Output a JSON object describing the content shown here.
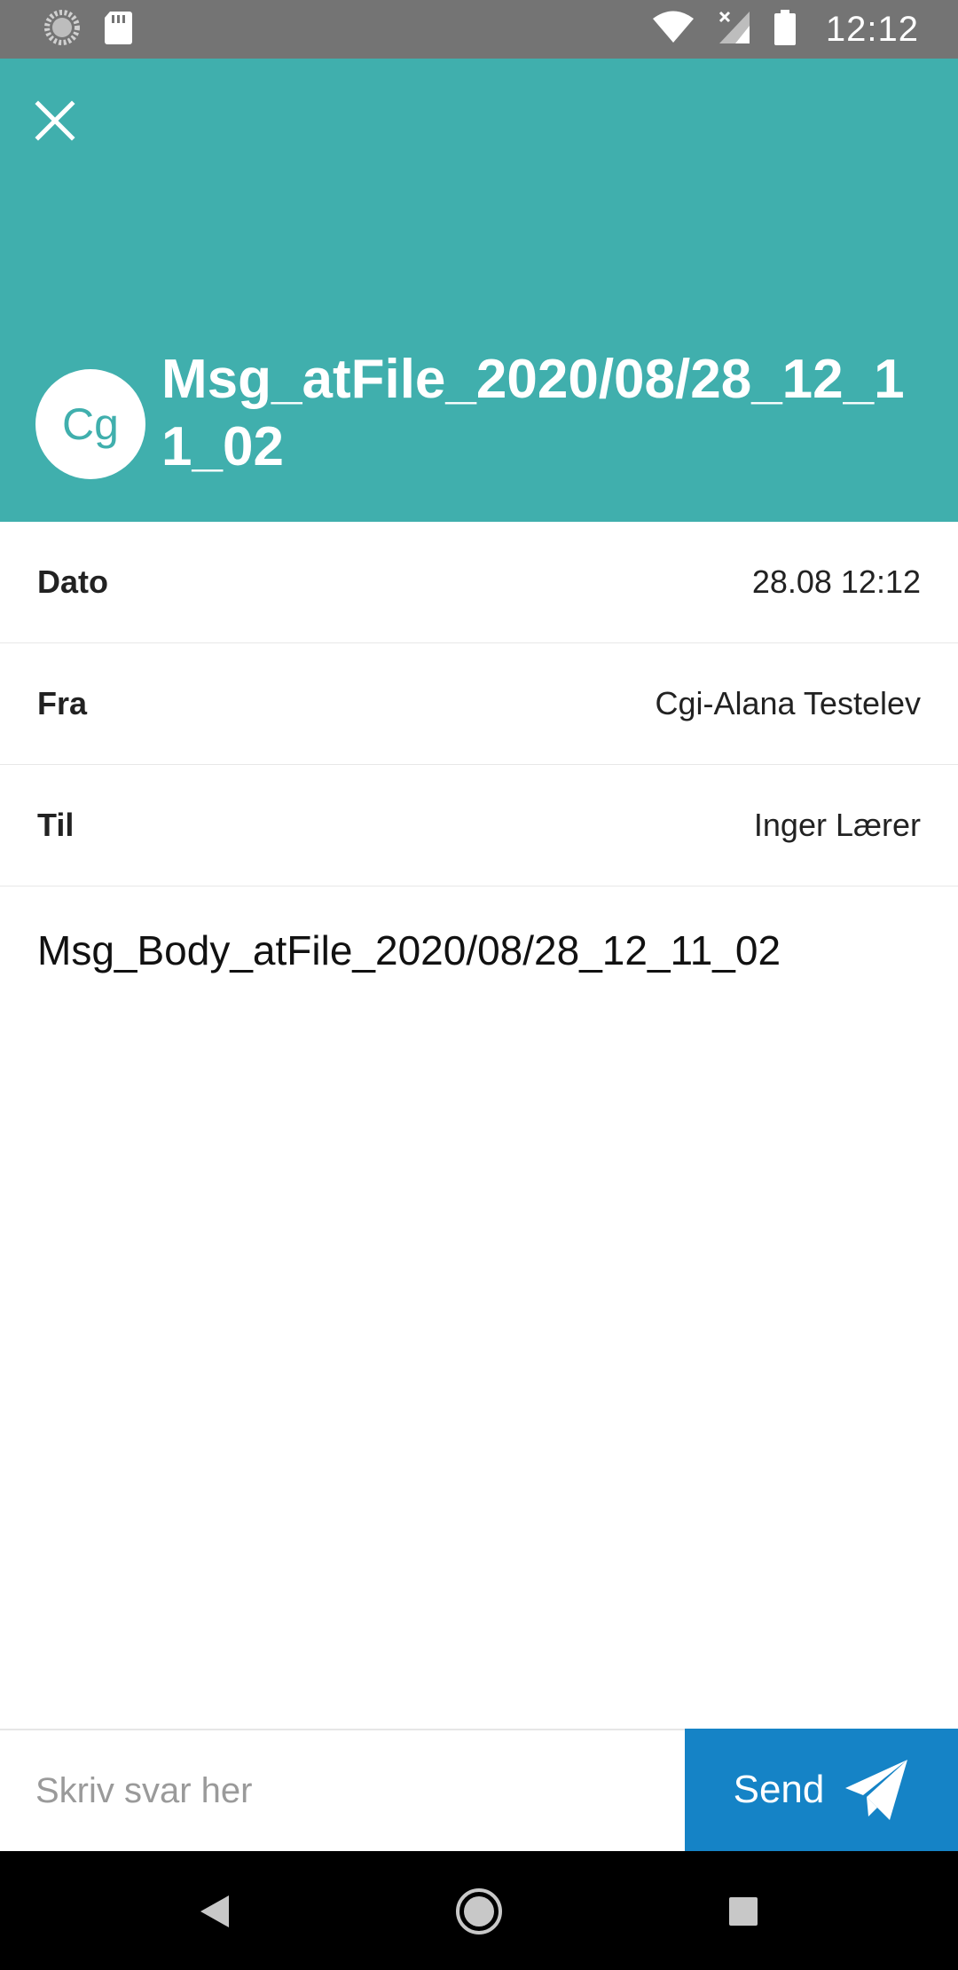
{
  "status_bar": {
    "time": "12:12",
    "icons": [
      "sync-icon",
      "sd-card-icon",
      "wifi-icon",
      "cellular-no-data-icon",
      "battery-icon"
    ],
    "background": "#747474"
  },
  "header": {
    "avatar_initials": "Cg",
    "title": "Msg_atFile_2020/08/28_12_11_02",
    "background": "#40afad"
  },
  "details": [
    {
      "label": "Dato",
      "value": "28.08 12:12"
    },
    {
      "label": "Fra",
      "value": "Cgi-Alana Testelev"
    },
    {
      "label": "Til",
      "value": "Inger Lærer"
    }
  ],
  "message": {
    "body": "Msg_Body_atFile_2020/08/28_12_11_02"
  },
  "reply": {
    "placeholder": "Skriv svar her",
    "value": "",
    "send_label": "Send",
    "send_color": "#1583c6"
  },
  "nav_bar": {
    "buttons": [
      "back-icon",
      "home-icon",
      "recents-icon"
    ]
  }
}
